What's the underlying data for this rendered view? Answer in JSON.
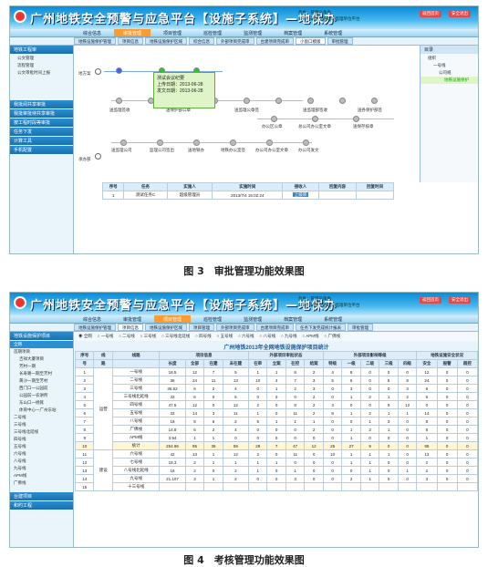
{
  "header": {
    "title": "广州地铁安全预警与应急平台【设施子系统】—地保办",
    "user_role_label": "角色：",
    "user_role": "管理员角色",
    "company_label": "公司：",
    "company": "轨道交通建设监理单位平台",
    "btn_home": "返回首页",
    "btn_exit": "安全退出"
  },
  "nav": [
    "综合信息",
    "审批管理",
    "项目管理",
    "巡检管理",
    "监测管理",
    "档案管理",
    "系统管理"
  ],
  "shot1": {
    "tabs": [
      "地铁设施保护管理",
      "项目信息",
      "地铁设施保护区域",
      "综合信息",
      "外部项目完成审",
      "台建项目完成审",
      "小窗口模版",
      "审批管理"
    ],
    "sidebar": {
      "section1": "地铁工程审",
      "items1": [
        "公文管理",
        "流程管理",
        "公文审批时间上报"
      ],
      "sections": [
        "我批阅共享审批",
        "我批审批待共享审批",
        "按工程时段等审批",
        "任务下发",
        "计算工具",
        "手机配置"
      ]
    },
    "lane_labels": [
      "地方案",
      "承办部"
    ],
    "top_nodes": [
      "申请下发",
      "送监理公司",
      "监理公司",
      "送地铁公司",
      "地铁公司审批",
      "审批下发",
      "送监理公司盖章",
      "送监理公司签",
      "送总监盖章"
    ],
    "mid_nodes": [
      "送监理签收",
      "送保护部公章",
      "送监理公章签",
      "送监理部签收",
      "送各保护部签",
      "办公区公章",
      "总公司办公室文章",
      "送保存核章"
    ],
    "bottom_nodes": [
      "送监理公司",
      "监理公司签出",
      "送地铁办",
      "地铁办公室签",
      "办公司办公室文章",
      "办公司发文"
    ],
    "popup": {
      "title": "测试会议纪要",
      "upload_label": "上传日期：",
      "upload_date": "2013-06-28",
      "send_label": "发文日期：",
      "send_date": "2013-06-28"
    },
    "tree": {
      "title": "目录",
      "root": "组织",
      "items": [
        "一号线",
        "公司规",
        "地铁设施保护"
      ]
    },
    "table_headers": [
      "序号",
      "任务",
      "实施人",
      "实施时间",
      "接收人",
      "回复内容",
      "回复时间"
    ],
    "table_rows": [
      [
        "1",
        "测试任务C",
        "超级管理员",
        "2013/7/4 15:02:24",
        "上级审",
        "",
        ""
      ]
    ]
  },
  "shot2": {
    "tabs": [
      "地铁设施保护管理",
      "项目信息",
      "地铁设施保护区域",
      "项目管理",
      "外部项目完成审",
      "台建项目完成审",
      "任务下发完成统计报表",
      "审批管理"
    ],
    "sidebar": {
      "section1": "地铁设施保护项目",
      "tree": [
        "全网",
        "首期项目",
        "吉祥大厦项目",
        "芳村一期",
        "长寿路一期至芳村",
        "黄沙一期至芳村",
        "西门口一公园前",
        "公园前一农讲所",
        "东山口一杨箕",
        "体育中心一广州东站",
        "二号线",
        "三号线",
        "三号线北延线",
        "四号线",
        "五号线",
        "六号线",
        "八号线",
        "九号线",
        "APM线",
        "广佛线"
      ],
      "sections": [
        "台建项目",
        "和约工程"
      ]
    },
    "radios": [
      "全网",
      "一号线",
      "二号线",
      "三号线",
      "三号线北延线",
      "四号线",
      "五号线",
      "六号线",
      "八号线",
      "九号线",
      "APM线",
      "广佛线"
    ],
    "report_title": "广州地铁2013年全网地铁设施保护项目统计",
    "group_headers": [
      "序号",
      "线",
      "线路",
      "项目信息",
      "外部项目审批状态",
      "外部项目影响等级",
      "地铁设施安全状况"
    ],
    "headers": [
      "号",
      "路",
      "",
      "长度",
      "全部",
      "在建",
      "未在建",
      "在审",
      "立案",
      "在控",
      "结案",
      "特级",
      "一级",
      "二级",
      "三级",
      "四级",
      "安全",
      "报警",
      "超控"
    ],
    "group_label_run": "运营",
    "group_label_build": "建设",
    "rows": [
      [
        "1",
        "",
        "一号线",
        "18.5",
        "12",
        "7",
        "5",
        "1",
        "1",
        "8",
        "2",
        "4",
        "8",
        "0",
        "0",
        "0",
        "12",
        "0",
        "0"
      ],
      [
        "2",
        "",
        "二号线",
        "36",
        "24",
        "11",
        "13",
        "10",
        "4",
        "7",
        "3",
        "5",
        "6",
        "0",
        "5",
        "8",
        "24",
        "0",
        "0"
      ],
      [
        "3",
        "",
        "三号线",
        "36.62",
        "6",
        "2",
        "4",
        "0",
        "1",
        "2",
        "3",
        "0",
        "3",
        "0",
        "0",
        "3",
        "6",
        "0",
        "0"
      ],
      [
        "4",
        "",
        "三号线北延线",
        "32",
        "6",
        "0",
        "6",
        "0",
        "0",
        "0",
        "2",
        "0",
        "1",
        "2",
        "1",
        "2",
        "6",
        "0",
        "0"
      ],
      [
        "5",
        "",
        "四号线",
        "47.5",
        "12",
        "0",
        "12",
        "2",
        "0",
        "8",
        "2",
        "3",
        "0",
        "0",
        "9",
        "12",
        "0",
        "0",
        "0"
      ],
      [
        "6",
        "",
        "五号线",
        "32",
        "14",
        "3",
        "11",
        "1",
        "0",
        "11",
        "2",
        "8",
        "1",
        "2",
        "1",
        "1",
        "14",
        "0",
        "0"
      ],
      [
        "7",
        "",
        "八号线",
        "18",
        "8",
        "6",
        "2",
        "5",
        "1",
        "1",
        "1",
        "0",
        "0",
        "1",
        "3",
        "0",
        "8",
        "0",
        "0"
      ],
      [
        "8",
        "",
        "广佛线",
        "14.8",
        "6",
        "2",
        "4",
        "0",
        "0",
        "0",
        "2",
        "0",
        "1",
        "2",
        "1",
        "0",
        "6",
        "0",
        "0"
      ],
      [
        "9",
        "",
        "APM线",
        "3.94",
        "1",
        "1",
        "0",
        "0",
        "0",
        "0",
        "0",
        "0",
        "1",
        "0",
        "0",
        "0",
        "1",
        "0",
        "0"
      ],
      [
        "10",
        "",
        "统计",
        "254.96",
        "95",
        "36",
        "59",
        "29",
        "7",
        "47",
        "12",
        "25",
        "27",
        "9",
        "0",
        "0",
        "95",
        "0",
        "0"
      ],
      [
        "11",
        "",
        "六号线",
        "42",
        "13",
        "1",
        "12",
        "2",
        "0",
        "11",
        "0",
        "10",
        "1",
        "1",
        "1",
        "0",
        "13",
        "0",
        "0"
      ],
      [
        "12",
        "",
        "七号线",
        "18.3",
        "2",
        "1",
        "1",
        "1",
        "1",
        "0",
        "0",
        "0",
        "1",
        "1",
        "0",
        "0",
        "2",
        "0",
        "0"
      ],
      [
        "13",
        "",
        "八号线北延线",
        "16",
        "2",
        "0",
        "2",
        "1",
        "0",
        "1",
        "0",
        "0",
        "0",
        "1",
        "0",
        "1",
        "2",
        "0",
        "0"
      ],
      [
        "14",
        "",
        "九号线",
        "21.107",
        "3",
        "1",
        "2",
        "0",
        "0",
        "3",
        "0",
        "0",
        "2",
        "1",
        "0",
        "0",
        "3",
        "0",
        "0"
      ],
      [
        "15",
        "",
        "十三号线",
        "",
        "",
        "",
        "",
        "",
        "",
        "",
        "",
        "",
        "",
        "",
        "",
        "",
        "",
        "",
        ""
      ]
    ]
  },
  "captions": [
    "图 3　审批管理功能效果图",
    "图 4　考核管理功能效果图"
  ]
}
